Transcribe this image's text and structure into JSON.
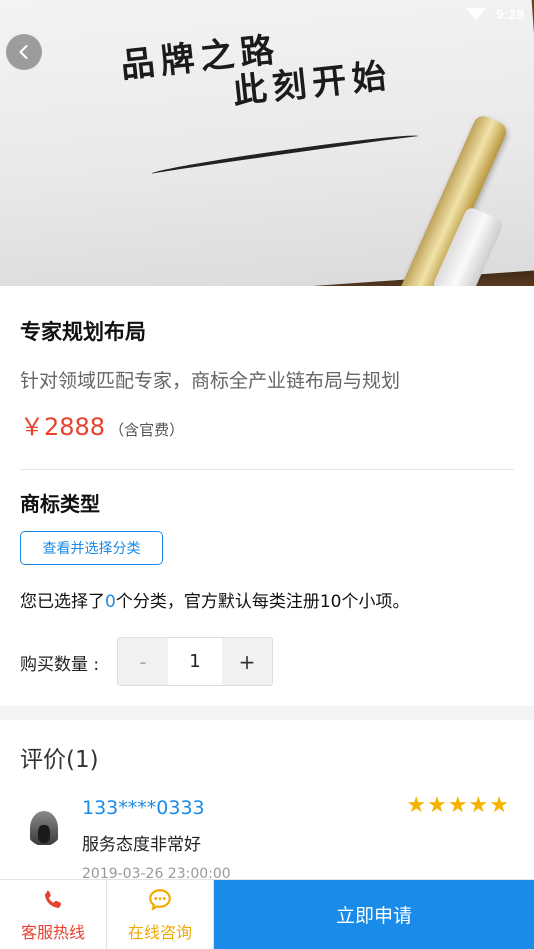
{
  "status_bar": {
    "time": "9:28"
  },
  "hero": {
    "line1": "品牌之路",
    "line2": "此刻开始"
  },
  "product": {
    "title": "专家规划布局",
    "subtitle": "针对领域匹配专家，商标全产业链布局与规划",
    "price": "￥2888",
    "price_note": "（含官费）"
  },
  "trademark": {
    "section_title": "商标类型",
    "category_button": "查看并选择分类",
    "selected_prefix": "您已选择了",
    "selected_count": "0",
    "selected_suffix": "个分类，官方默认每类注册10个小项。"
  },
  "quantity": {
    "label": "购买数量 :",
    "minus": "-",
    "value": "1",
    "plus": "+"
  },
  "reviews": {
    "title": "评价(1)",
    "items": [
      {
        "user": "133****0333",
        "stars": "★★★★★",
        "rating": 5,
        "text": "服务态度非常好",
        "date": "2019-03-26 23:00:00"
      }
    ]
  },
  "bottom_bar": {
    "hotline": "客服热线",
    "chat": "在线咨询",
    "apply": "立即申请"
  },
  "colors": {
    "accent": "#1a8be8",
    "price": "#e8412e",
    "hotline": "#e8412e",
    "chat": "#f2a900",
    "stars": "#f5b300"
  }
}
